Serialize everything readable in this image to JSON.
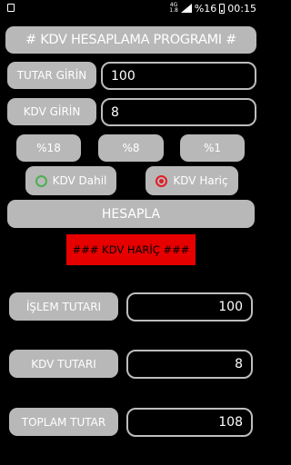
{
  "status_bar": {
    "network": "4G",
    "network_sub": "1.8",
    "battery_percent": "%16",
    "time": "00:15"
  },
  "title": "# KDV HESAPLAMA PROGRAMI #",
  "amount_input": {
    "label": "TUTAR GİRİN",
    "value": "100"
  },
  "vat_input": {
    "label": "KDV GİRİN",
    "value": "8"
  },
  "rate_buttons": [
    "%18",
    "%8",
    "%1"
  ],
  "vat_mode": {
    "options": [
      "KDV Dahil",
      "KDV Hariç"
    ],
    "selected": "KDV Hariç"
  },
  "calculate_label": "HESAPLA",
  "result_banner": "### KDV HARİÇ ###",
  "results": {
    "transaction_label": "İŞLEM TUTARI",
    "transaction_value": "100",
    "vat_label": "KDV TUTARI",
    "vat_value": "8",
    "total_label": "TOPLAM TUTAR",
    "total_value": "108"
  },
  "colors": {
    "button_gray": "#b8b8b8",
    "field_border": "#bdbdbd",
    "banner_red": "#e60000",
    "radio_green": "#4caf50",
    "radio_red": "#e31b23"
  }
}
